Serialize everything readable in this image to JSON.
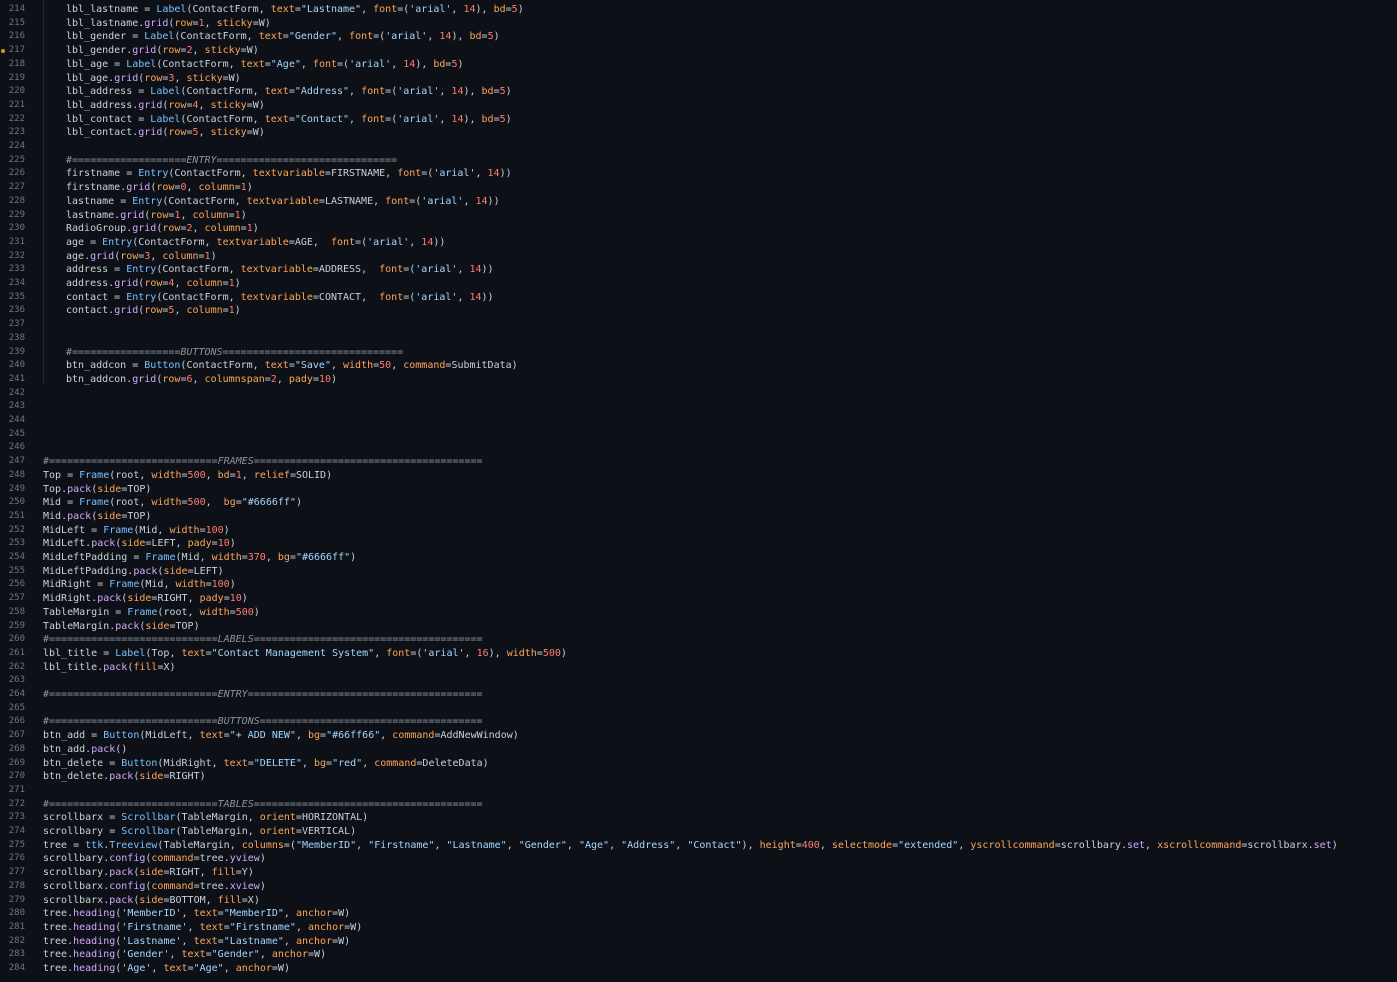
{
  "editor": {
    "first_line_number": 214,
    "modified_marker_line": 217,
    "lines": [
      {
        "n": "214",
        "indent": 1,
        "code": "lbl_lastname = Label(ContactForm, text=\"Lastname\", font=('arial', 14), bd=5)"
      },
      {
        "n": "215",
        "indent": 1,
        "code": "lbl_lastname.grid(row=1, sticky=W)"
      },
      {
        "n": "216",
        "indent": 1,
        "code": "lbl_gender = Label(ContactForm, text=\"Gender\", font=('arial', 14), bd=5)"
      },
      {
        "n": "217",
        "indent": 1,
        "code": "lbl_gender.grid(row=2, sticky=W)"
      },
      {
        "n": "218",
        "indent": 1,
        "code": "lbl_age = Label(ContactForm, text=\"Age\", font=('arial', 14), bd=5)"
      },
      {
        "n": "219",
        "indent": 1,
        "code": "lbl_age.grid(row=3, sticky=W)"
      },
      {
        "n": "220",
        "indent": 1,
        "code": "lbl_address = Label(ContactForm, text=\"Address\", font=('arial', 14), bd=5)"
      },
      {
        "n": "221",
        "indent": 1,
        "code": "lbl_address.grid(row=4, sticky=W)"
      },
      {
        "n": "222",
        "indent": 1,
        "code": "lbl_contact = Label(ContactForm, text=\"Contact\", font=('arial', 14), bd=5)"
      },
      {
        "n": "223",
        "indent": 1,
        "code": "lbl_contact.grid(row=5, sticky=W)"
      },
      {
        "n": "224",
        "indent": 1,
        "code": ""
      },
      {
        "n": "225",
        "indent": 1,
        "code": "#===================ENTRY=============================="
      },
      {
        "n": "226",
        "indent": 1,
        "code": "firstname = Entry(ContactForm, textvariable=FIRSTNAME, font=('arial', 14))"
      },
      {
        "n": "227",
        "indent": 1,
        "code": "firstname.grid(row=0, column=1)"
      },
      {
        "n": "228",
        "indent": 1,
        "code": "lastname = Entry(ContactForm, textvariable=LASTNAME, font=('arial', 14))"
      },
      {
        "n": "229",
        "indent": 1,
        "code": "lastname.grid(row=1, column=1)"
      },
      {
        "n": "230",
        "indent": 1,
        "code": "RadioGroup.grid(row=2, column=1)"
      },
      {
        "n": "231",
        "indent": 1,
        "code": "age = Entry(ContactForm, textvariable=AGE,  font=('arial', 14))"
      },
      {
        "n": "232",
        "indent": 1,
        "code": "age.grid(row=3, column=1)"
      },
      {
        "n": "233",
        "indent": 1,
        "code": "address = Entry(ContactForm, textvariable=ADDRESS,  font=('arial', 14))"
      },
      {
        "n": "234",
        "indent": 1,
        "code": "address.grid(row=4, column=1)"
      },
      {
        "n": "235",
        "indent": 1,
        "code": "contact = Entry(ContactForm, textvariable=CONTACT,  font=('arial', 14))"
      },
      {
        "n": "236",
        "indent": 1,
        "code": "contact.grid(row=5, column=1)"
      },
      {
        "n": "237",
        "indent": 1,
        "code": ""
      },
      {
        "n": "238",
        "indent": 1,
        "code": ""
      },
      {
        "n": "239",
        "indent": 1,
        "code": "#==================BUTTONS=============================="
      },
      {
        "n": "240",
        "indent": 1,
        "code": "btn_addcon = Button(ContactForm, text=\"Save\", width=50, command=SubmitData)"
      },
      {
        "n": "241",
        "indent": 1,
        "code": "btn_addcon.grid(row=6, columnspan=2, pady=10)"
      },
      {
        "n": "242",
        "indent": 1,
        "code": ""
      },
      {
        "n": "243",
        "indent": 1,
        "code": ""
      },
      {
        "n": "244",
        "indent": 1,
        "code": ""
      },
      {
        "n": "245",
        "indent": 1,
        "code": ""
      },
      {
        "n": "246",
        "indent": 1,
        "code": ""
      },
      {
        "n": "247",
        "indent": 0,
        "code": "#============================FRAMES======================================"
      },
      {
        "n": "248",
        "indent": 0,
        "code": "Top = Frame(root, width=500, bd=1, relief=SOLID)"
      },
      {
        "n": "249",
        "indent": 0,
        "code": "Top.pack(side=TOP)"
      },
      {
        "n": "250",
        "indent": 0,
        "code": "Mid = Frame(root, width=500,  bg=\"#6666ff\")"
      },
      {
        "n": "251",
        "indent": 0,
        "code": "Mid.pack(side=TOP)"
      },
      {
        "n": "252",
        "indent": 0,
        "code": "MidLeft = Frame(Mid, width=100)"
      },
      {
        "n": "253",
        "indent": 0,
        "code": "MidLeft.pack(side=LEFT, pady=10)"
      },
      {
        "n": "254",
        "indent": 0,
        "code": "MidLeftPadding = Frame(Mid, width=370, bg=\"#6666ff\")"
      },
      {
        "n": "255",
        "indent": 0,
        "code": "MidLeftPadding.pack(side=LEFT)"
      },
      {
        "n": "256",
        "indent": 0,
        "code": "MidRight = Frame(Mid, width=100)"
      },
      {
        "n": "257",
        "indent": 0,
        "code": "MidRight.pack(side=RIGHT, pady=10)"
      },
      {
        "n": "258",
        "indent": 0,
        "code": "TableMargin = Frame(root, width=500)"
      },
      {
        "n": "259",
        "indent": 0,
        "code": "TableMargin.pack(side=TOP)"
      },
      {
        "n": "260",
        "indent": 0,
        "code": "#============================LABELS======================================"
      },
      {
        "n": "261",
        "indent": 0,
        "code": "lbl_title = Label(Top, text=\"Contact Management System\", font=('arial', 16), width=500)"
      },
      {
        "n": "262",
        "indent": 0,
        "code": "lbl_title.pack(fill=X)"
      },
      {
        "n": "263",
        "indent": 0,
        "code": ""
      },
      {
        "n": "264",
        "indent": 0,
        "code": "#============================ENTRY======================================="
      },
      {
        "n": "265",
        "indent": 0,
        "code": ""
      },
      {
        "n": "266",
        "indent": 0,
        "code": "#============================BUTTONS====================================="
      },
      {
        "n": "267",
        "indent": 0,
        "code": "btn_add = Button(MidLeft, text=\"+ ADD NEW\", bg=\"#66ff66\", command=AddNewWindow)"
      },
      {
        "n": "268",
        "indent": 0,
        "code": "btn_add.pack()"
      },
      {
        "n": "269",
        "indent": 0,
        "code": "btn_delete = Button(MidRight, text=\"DELETE\", bg=\"red\", command=DeleteData)"
      },
      {
        "n": "270",
        "indent": 0,
        "code": "btn_delete.pack(side=RIGHT)"
      },
      {
        "n": "271",
        "indent": 0,
        "code": ""
      },
      {
        "n": "272",
        "indent": 0,
        "code": "#============================TABLES======================================"
      },
      {
        "n": "273",
        "indent": 0,
        "code": "scrollbarx = Scrollbar(TableMargin, orient=HORIZONTAL)"
      },
      {
        "n": "274",
        "indent": 0,
        "code": "scrollbary = Scrollbar(TableMargin, orient=VERTICAL)"
      },
      {
        "n": "275",
        "indent": 0,
        "code": "tree = ttk.Treeview(TableMargin, columns=(\"MemberID\", \"Firstname\", \"Lastname\", \"Gender\", \"Age\", \"Address\", \"Contact\"), height=400, selectmode=\"extended\", yscrollcommand=scrollbary.set, xscrollcommand=scrollbarx.set)"
      },
      {
        "n": "276",
        "indent": 0,
        "code": "scrollbary.config(command=tree.yview)"
      },
      {
        "n": "277",
        "indent": 0,
        "code": "scrollbary.pack(side=RIGHT, fill=Y)"
      },
      {
        "n": "278",
        "indent": 0,
        "code": "scrollbarx.config(command=tree.xview)"
      },
      {
        "n": "279",
        "indent": 0,
        "code": "scrollbarx.pack(side=BOTTOM, fill=X)"
      },
      {
        "n": "280",
        "indent": 0,
        "code": "tree.heading('MemberID', text=\"MemberID\", anchor=W)"
      },
      {
        "n": "281",
        "indent": 0,
        "code": "tree.heading('Firstname', text=\"Firstname\", anchor=W)"
      },
      {
        "n": "282",
        "indent": 0,
        "code": "tree.heading('Lastname', text=\"Lastname\", anchor=W)"
      },
      {
        "n": "283",
        "indent": 0,
        "code": "tree.heading('Gender', text=\"Gender\", anchor=W)"
      },
      {
        "n": "284",
        "indent": 0,
        "code": "tree.heading('Age', text=\"Age\", anchor=W)"
      }
    ]
  },
  "colors": {
    "background": "#0d1117",
    "line_number": "#6e7681",
    "function": "#79c0ff",
    "method": "#d2a8ff",
    "string": "#a5d6ff",
    "number": "#ff7b72",
    "keyword_arg": "#ffa657",
    "comment": "#8b949e",
    "marker": "#d29922"
  }
}
